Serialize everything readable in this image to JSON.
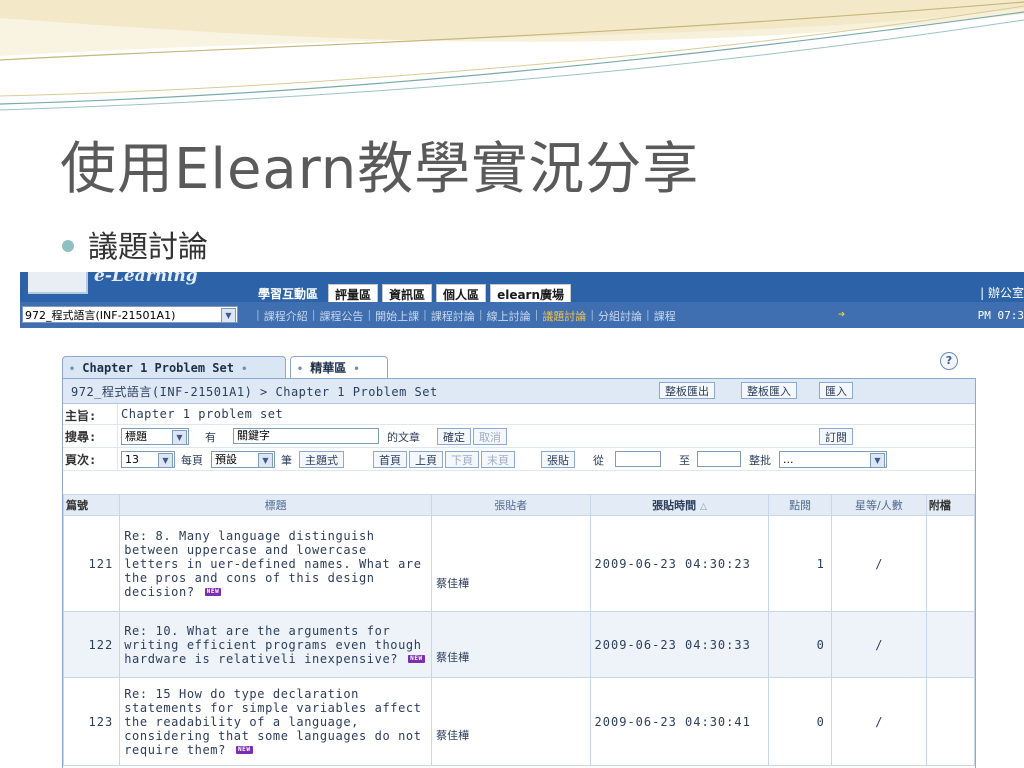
{
  "slide": {
    "title": "使用Elearn教學實況分享",
    "bullet": "議題討論"
  },
  "app": {
    "logo_text": "e-Learning",
    "main_nav": [
      "學習互動區",
      "評量區",
      "資訊區",
      "個人區",
      "elearn廣場"
    ],
    "header_right": "| 辦公室",
    "course_select": "972_程式語言(INF-21501A1)",
    "sub_nav": [
      "課程介紹",
      "課程公告",
      "開始上課",
      "課程討論",
      "線上討論",
      "議題討論",
      "分組討論",
      "課程"
    ],
    "sub_nav_active": "議題討論",
    "time_text": "PM 07:3"
  },
  "tabs": [
    {
      "label": "Chapter 1 Problem Set"
    },
    {
      "label": "精華區"
    }
  ],
  "board": {
    "breadcrumb": "972_程式語言(INF-21501A1) > Chapter 1 Problem Set",
    "buttons": {
      "export": "整板匯出",
      "import": "整板匯入",
      "merge": "匯入"
    },
    "subject": {
      "label": "主旨:",
      "value": "Chapter 1 problem set"
    },
    "search": {
      "label": "搜尋:",
      "field": "標題",
      "has": "有",
      "keyword": "關鍵字",
      "of_articles": "的文章",
      "confirm": "確定",
      "cancel": "取消",
      "subscribe": "訂閱"
    },
    "paging": {
      "label": "頁次:",
      "page": "13",
      "per_page": "每頁",
      "per_page_value": "預設",
      "unit": "筆",
      "thread_mode": "主題式",
      "first": "首頁",
      "prev": "上頁",
      "next": "下頁",
      "last": "末頁",
      "post": "張貼",
      "from": "從",
      "to": "至",
      "batch": "整批",
      "batch_value": "..."
    },
    "columns": {
      "id": "篇號",
      "title": "標題",
      "poster": "張貼者",
      "time": "張貼時間",
      "views": "點閱",
      "rating": "星等/人數",
      "attach": "附檔"
    },
    "new_badge": "NEW",
    "rows": [
      {
        "id": "121",
        "title": "Re: 8. Many language distinguish between uppercase and lowercase letters in uer-defined names. What are the pros and cons of this design decision?",
        "poster": "蔡佳樺",
        "time": "2009-06-23 04:30:23",
        "views": "1",
        "rating": "/"
      },
      {
        "id": "122",
        "title": "Re: 10. What are the arguments for writing efficient programs even though hardware is relativeli inexpensive?",
        "poster": "蔡佳樺",
        "time": "2009-06-23 04:30:33",
        "views": "0",
        "rating": "/"
      },
      {
        "id": "123",
        "title": "Re: 15 How do type declaration statements for simple variables affect the readability of a language, considering that some languages do not require them?",
        "poster": "蔡佳樺",
        "time": "2009-06-23 04:30:41",
        "views": "0",
        "rating": "/"
      }
    ]
  },
  "colors": {
    "header_blue": "#2c63a8",
    "sub_blue": "#3f6fb0",
    "active_link": "#f2c14e",
    "new_badge": "#7a2fb0"
  }
}
